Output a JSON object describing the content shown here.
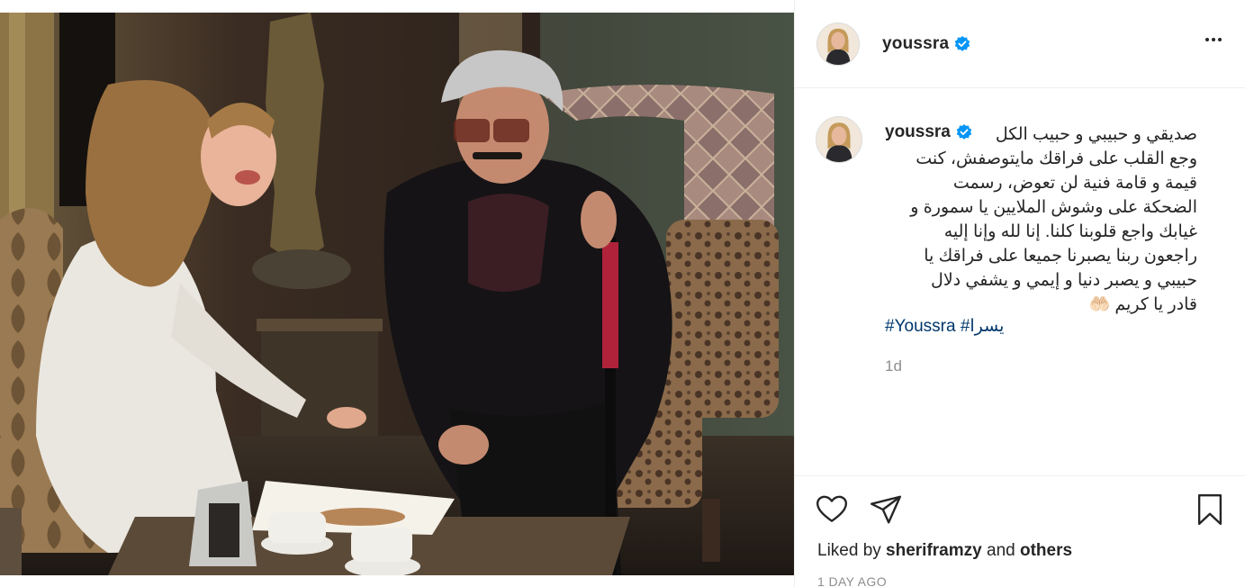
{
  "header": {
    "username": "youssra",
    "avatar_icon": "profile-avatar",
    "verified_icon": "verified-badge-icon",
    "more_icon": "more-options-icon"
  },
  "caption": {
    "username": "youssra",
    "text": "صديقي و حبيبي و حبيب الكل\nوجع القلب على فراقك مايتوصفش، كنت\nقيمة و قامة فنية لن تعوض، رسمت\nالضحكة على وشوش الملايين يا سمورة و\nغيابك واجع قلوبنا كلنا. إنا لله وإنا إليه\nراجعون ربنا يصبرنا جميعا على فراقك يا\nحبيبي و يصبر دنيا و إيمي و يشفي دلال\nقادر يا كريم 🤲🏻",
    "hashtags": [
      "#Youssra",
      "#يسرا"
    ],
    "age": "1d"
  },
  "actions": {
    "like_icon": "heart-icon",
    "share_icon": "paper-plane-icon",
    "save_icon": "bookmark-icon",
    "liked_by_prefix": "Liked by ",
    "liked_by_user": "sheriframzy",
    "liked_by_and": " and ",
    "liked_by_others": "others",
    "timestamp": "1 DAY AGO"
  },
  "colors": {
    "link": "#00376b",
    "verified": "#0095f6",
    "muted": "#8e8e8e",
    "divider": "#efefef"
  }
}
